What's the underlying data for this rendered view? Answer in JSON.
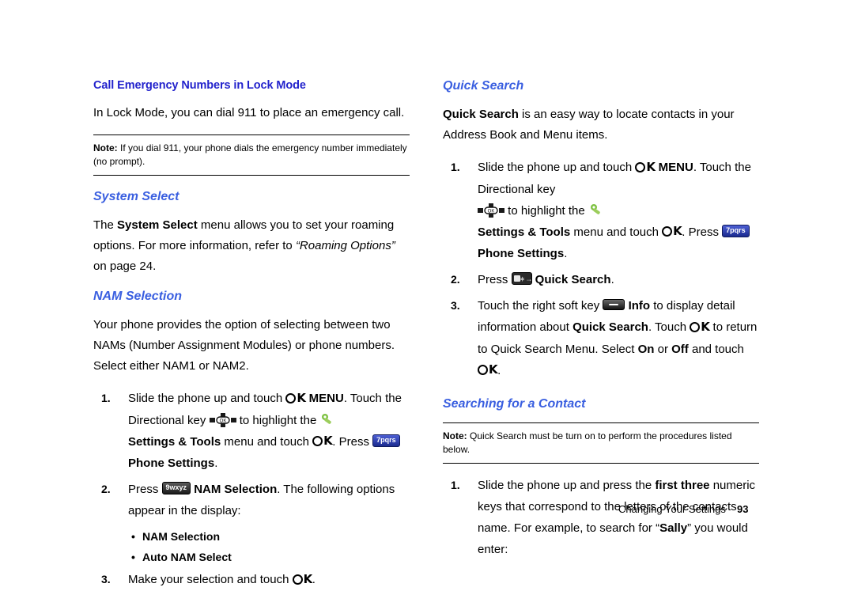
{
  "document": {
    "footer": {
      "section": "Changing Your Settings",
      "page": "93"
    }
  },
  "left_column": {
    "section1": {
      "heading": "Call Emergency Numbers in Lock Mode",
      "body": "In Lock Mode, you can dial 911 to place an emergency call.",
      "note_label": "Note:",
      "note_text": "If you dial 911, your phone dials the emergency number immediately (no prompt)."
    },
    "section2": {
      "heading": "System Select",
      "body_a": "The ",
      "body_b": "System Select",
      "body_c": " menu allows you to set your roaming options. For more information, refer to ",
      "body_d": "“Roaming Options”",
      "body_e": " on page 24."
    },
    "section3": {
      "heading": "NAM Selection",
      "body": "Your phone provides the option of selecting between two NAMs (Number Assignment Modules) or phone numbers. Select either NAM1 or NAM2.",
      "steps": [
        {
          "num": "1.",
          "t1": "Slide the phone up and touch ",
          "k1": "OK",
          "t2": " MENU",
          "t3": ". Touch the Directional key ",
          "t4": " to highlight the ",
          "t5": "Settings & Tools",
          "t6": " menu and touch ",
          "k2": "OK",
          "t7": ". Press ",
          "k3": "7pqrs",
          "t8": "Phone Settings",
          "t9": "."
        },
        {
          "num": "2.",
          "t1": "Press ",
          "k1": "9wxyz",
          "t2": " NAM Selection",
          "t3": ". The following options appear in the display:"
        },
        {
          "num": "3.",
          "t1": "Make your selection and touch ",
          "k1": "OK",
          "t2": "."
        }
      ],
      "bullets": [
        "NAM Selection",
        "Auto NAM Select"
      ]
    }
  },
  "right_column": {
    "section1": {
      "heading": "Quick Search",
      "body_b": "Quick Search",
      "body_c": " is an easy way to locate contacts in your Address Book and Menu items.",
      "steps": [
        {
          "num": "1.",
          "t1": "Slide the phone up and touch ",
          "k1": "OK",
          "t2": " MENU",
          "t3": ". Touch the Directional key ",
          "t4": " to highlight the ",
          "t5": "Settings & Tools",
          "t6": " menu and touch ",
          "k2": "OK",
          "t7": ". Press ",
          "k3": "7pqrs",
          "t8": "Phone Settings",
          "t9": "."
        },
        {
          "num": "2.",
          "t1": "Press ",
          "k1": "*",
          "t2": " Quick Search",
          "t3": "."
        },
        {
          "num": "3.",
          "t1": "Touch the right soft key ",
          "t2": " Info",
          "t3": " to display detail information about ",
          "t4": "Quick Search",
          "t5": ". Touch ",
          "k1": "OK",
          "t6": " to return to Quick Search Menu. Select ",
          "t7": "On",
          "t8": " or ",
          "t9": "Off",
          "t10": " and touch ",
          "k2": "OK",
          "t11": "."
        }
      ]
    },
    "section2": {
      "heading": "Searching for a Contact",
      "note_label": "Note:",
      "note_text": "Quick Search must be turn on to perform the procedures listed below.",
      "steps": [
        {
          "num": "1.",
          "t1": "Slide the phone up and press the ",
          "t2": "first three",
          "t3": " numeric keys that correspond to the letters of the contacts name. For example, to search for “",
          "t4": "Sally",
          "t5": "” you would enter:"
        }
      ]
    }
  },
  "icons": {
    "ok_key": "ok-key-icon",
    "nav_key": "directional-key-icon",
    "tools_key": "settings-tools-icon",
    "soft_key": "soft-key-icon",
    "star_key": "star-key-icon"
  }
}
